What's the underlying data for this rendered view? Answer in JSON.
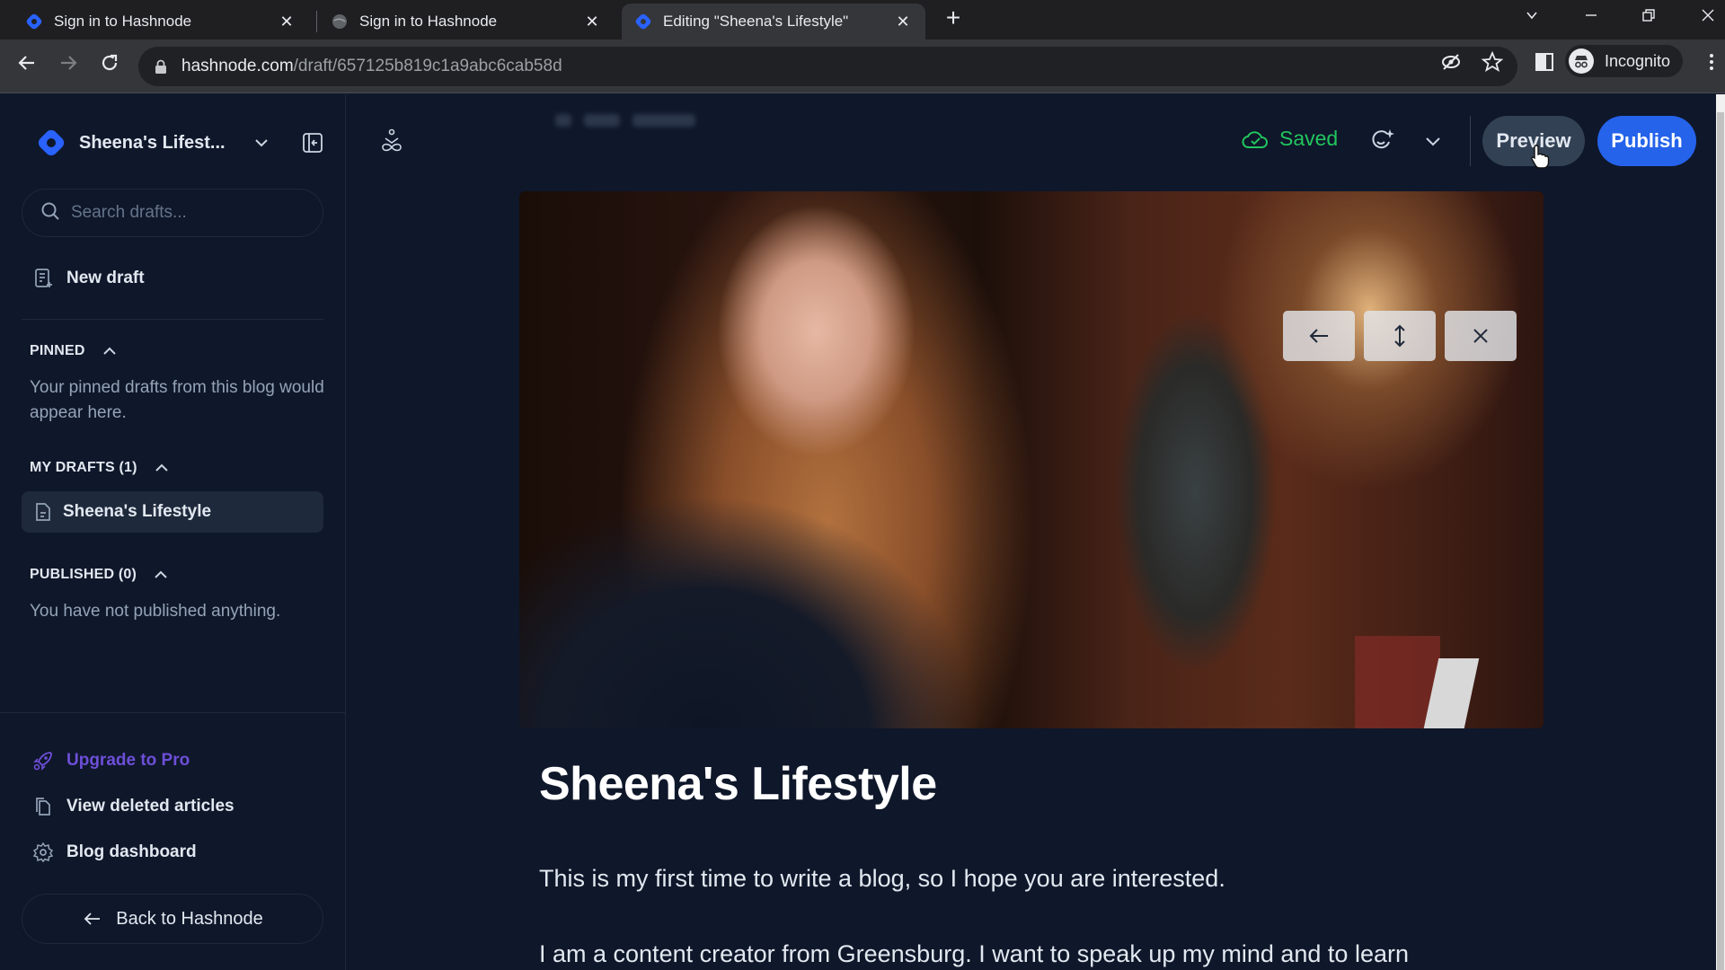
{
  "browser": {
    "tabs": [
      {
        "title": "Sign in to Hashnode",
        "icon": "hashnode-icon",
        "active": false
      },
      {
        "title": "Sign in to Hashnode",
        "icon": "globe-icon",
        "active": false
      },
      {
        "title": "Editing \"Sheena's Lifestyle\"",
        "icon": "hashnode-icon",
        "active": true
      }
    ],
    "new_tab": "+",
    "url_host": "hashnode.com",
    "url_path": "/draft/657125b819c1a9abc6cab58d",
    "profile_label": "Incognito"
  },
  "sidebar": {
    "blog_name": "Sheena's Lifest...",
    "search_placeholder": "Search drafts...",
    "new_draft": "New draft",
    "pinned": {
      "heading": "PINNED",
      "empty_text": "Your pinned drafts from this blog would appear here."
    },
    "my_drafts": {
      "heading": "MY DRAFTS (1)",
      "items": [
        "Sheena's Lifestyle"
      ]
    },
    "published": {
      "heading": "PUBLISHED (0)",
      "empty_text": "You have not published anything."
    },
    "footer_links": [
      {
        "label": "Upgrade to Pro",
        "icon": "rocket-icon"
      },
      {
        "label": "View deleted articles",
        "icon": "documents-icon"
      },
      {
        "label": "Blog dashboard",
        "icon": "gear-icon"
      }
    ],
    "back_label": "Back to Hashnode"
  },
  "editor": {
    "save_status": "Saved",
    "preview_label": "Preview",
    "publish_label": "Publish",
    "cover_tools": [
      "move-left",
      "reposition",
      "remove"
    ],
    "title": "Sheena's Lifestyle",
    "paragraphs": [
      "This is my first time to write a blog, so I hope you are interested.",
      "I am a content creator from Greensburg. I want to speak up my mind and to learn"
    ]
  },
  "colors": {
    "background": "#0f172a",
    "accent": "#2563eb",
    "saved": "#22c55e",
    "upgrade": "#6d4fd8"
  }
}
